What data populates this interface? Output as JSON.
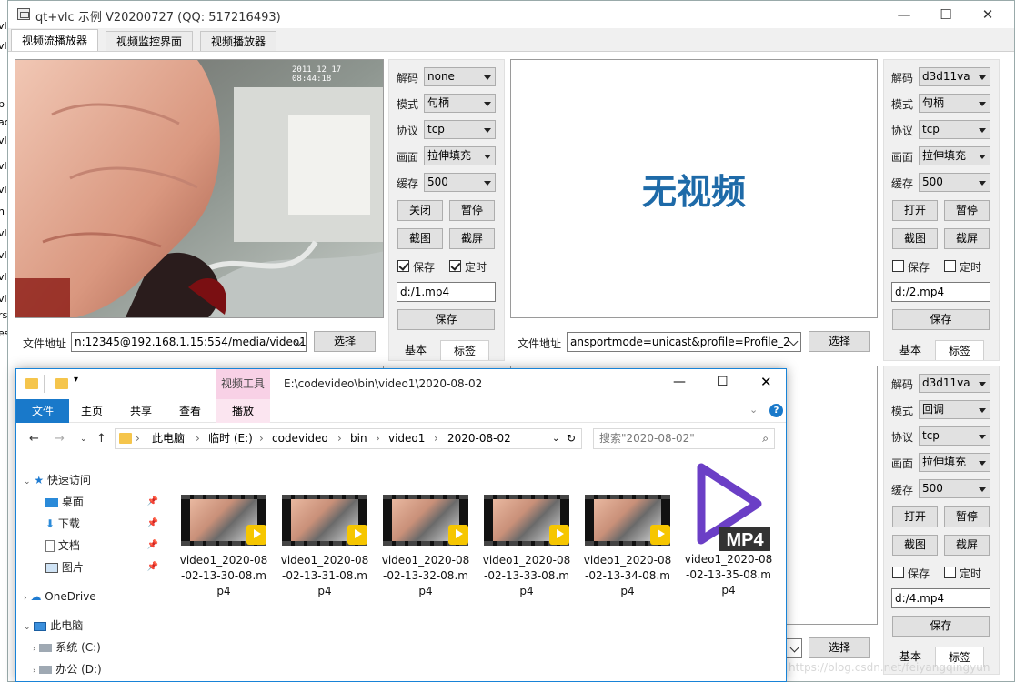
{
  "window": {
    "title": "qt+vlc 示例 V20200727 (QQ: 517216493)",
    "minimize": "—",
    "maximize": "☐",
    "close": "✕"
  },
  "tabs": [
    "视频流播放器",
    "视频监控界面",
    "视频播放器"
  ],
  "left_strip": [
    "vl",
    "vl",
    "p",
    "ac",
    "vl",
    "vl",
    "vl",
    "n",
    "vl",
    "vl",
    "vl",
    "vl",
    "rs",
    "es"
  ],
  "panels": {
    "p1": {
      "overlay_time": "2011 12 17 08:44:18",
      "decode_label": "解码",
      "decode_value": "none",
      "mode_label": "模式",
      "mode_value": "句柄",
      "proto_label": "协议",
      "proto_value": "tcp",
      "screen_label": "画面",
      "screen_value": "拉伸填充",
      "cache_label": "缓存",
      "cache_value": "500",
      "btn_open": "关闭",
      "btn_pause": "暂停",
      "btn_snap": "截图",
      "btn_screen": "截屏",
      "save_label": "保存",
      "timer_label": "定时",
      "path": "d:/1.mp4",
      "save_btn": "保存",
      "tab_basic": "基本",
      "tab_tag": "标签",
      "url_label": "文件地址",
      "url": "n:12345@192.168.1.15:554/media/video1",
      "choose": "选择"
    },
    "p2": {
      "no_video": "无视频",
      "decode_label": "解码",
      "decode_value": "d3d11va",
      "mode_label": "模式",
      "mode_value": "句柄",
      "proto_label": "协议",
      "proto_value": "tcp",
      "screen_label": "画面",
      "screen_value": "拉伸填充",
      "cache_label": "缓存",
      "cache_value": "500",
      "btn_open": "打开",
      "btn_pause": "暂停",
      "btn_snap": "截图",
      "btn_screen": "截屏",
      "save_label": "保存",
      "timer_label": "定时",
      "path": "d:/2.mp4",
      "save_btn": "保存",
      "tab_basic": "基本",
      "tab_tag": "标签",
      "url_label": "文件地址",
      "url": "ansportmode=unicast&profile=Profile_2",
      "choose": "选择"
    },
    "p4": {
      "decode_label": "解码",
      "decode_value": "d3d11va",
      "mode_label": "模式",
      "mode_value": "回调",
      "proto_label": "协议",
      "proto_value": "tcp",
      "screen_label": "画面",
      "screen_value": "拉伸填充",
      "cache_label": "缓存",
      "cache_value": "500",
      "btn_open": "打开",
      "btn_pause": "暂停",
      "btn_snap": "截图",
      "btn_screen": "截屏",
      "save_label": "保存",
      "timer_label": "定时",
      "path": "d:/4.mp4",
      "save_btn": "保存",
      "tab_basic": "基本",
      "tab_tag": "标签",
      "choose": "选择"
    }
  },
  "explorer": {
    "title_path": "E:\\codevideo\\bin\\video1\\2020-08-02",
    "video_tools": "视频工具",
    "play": "播放",
    "ribbon_tabs": [
      "文件",
      "主页",
      "共享",
      "查看"
    ],
    "help": "?",
    "breadcrumb": [
      "此电脑",
      "临时 (E:)",
      "codevideo",
      "bin",
      "video1",
      "2020-08-02"
    ],
    "search_placeholder": "搜索\"2020-08-02\"",
    "nav": {
      "quick_access": "快速访问",
      "desktop": "桌面",
      "downloads": "下载",
      "documents": "文档",
      "pictures": "图片",
      "onedrive": "OneDrive",
      "this_pc": "此电脑",
      "drive_c": "系统 (C:)",
      "drive_d": "办公 (D:)"
    },
    "files": [
      {
        "name": "video1_2020-08-02-13-30-08.mp4"
      },
      {
        "name": "video1_2020-08-02-13-31-08.mp4"
      },
      {
        "name": "video1_2020-08-02-13-32-08.mp4"
      },
      {
        "name": "video1_2020-08-02-13-33-08.mp4"
      },
      {
        "name": "video1_2020-08-02-13-34-08.mp4"
      },
      {
        "name": "video1_2020-08-02-13-35-08.mp4"
      }
    ],
    "mp4_label": "MP4"
  },
  "watermark": "https://blog.csdn.net/feiyangqingyun",
  "colors": {
    "accent": "#1e6aa8",
    "explorer_blue": "#1883d7",
    "video_tools": "#f8d1e6",
    "mp4_purple": "#6b3fc6"
  }
}
